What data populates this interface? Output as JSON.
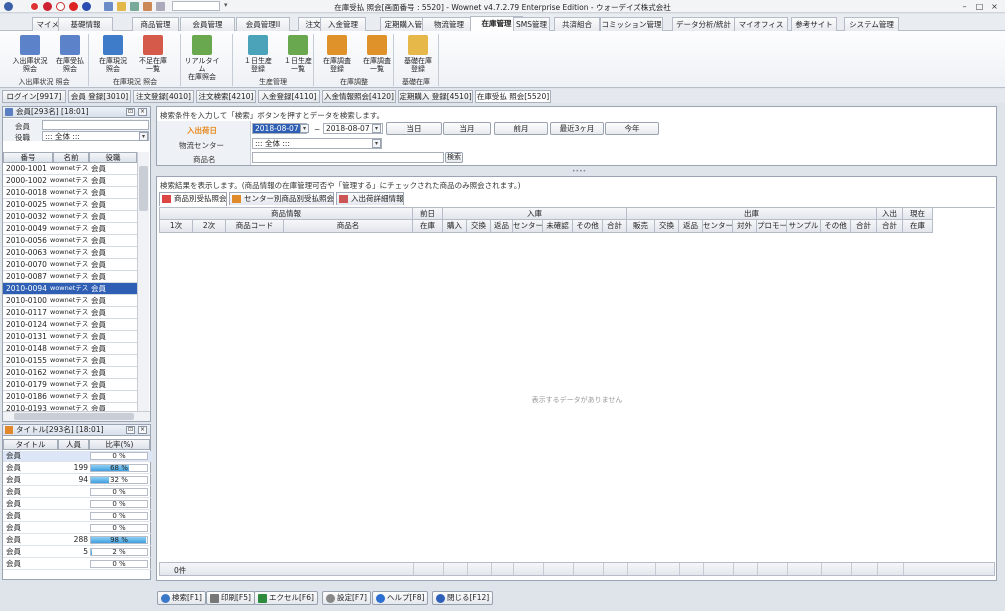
{
  "window": {
    "title": "在庫受払 照会[画面番号 : 5520] - Wownet v4.7.2.79 Enterprise Edition - ウォーデイズ株式会社"
  },
  "menu": {
    "tabs": [
      "マイメニュー",
      "基礎情報",
      "商品管理",
      "会員管理",
      "会員管理II",
      "注文管理",
      "入金管理",
      "定期購入管理",
      "物流管理",
      "在庫管理",
      "SMS管理",
      "共済組合",
      "コミッション管理",
      "データ分析/統計",
      "マイオフィス",
      "参考サイト",
      "システム管理"
    ],
    "active": "在庫管理"
  },
  "ribbon": {
    "buttons": [
      {
        "l1": "入出庫状況",
        "l2": "照会"
      },
      {
        "l1": "在庫受払",
        "l2": "照会"
      },
      {
        "l1": "在庫現況",
        "l2": "照会"
      },
      {
        "l1": "不足在庫",
        "l2": "一覧"
      },
      {
        "l1": "リアルタイム",
        "l2": "在庫照会"
      },
      {
        "l1": "１日生産",
        "l2": "登録"
      },
      {
        "l1": "１日生産",
        "l2": "一覧"
      },
      {
        "l1": "在庫調査",
        "l2": "登録"
      },
      {
        "l1": "在庫調査",
        "l2": "一覧"
      },
      {
        "l1": "基礎在庫",
        "l2": "登録"
      }
    ],
    "groups": [
      "入出庫状況 照会",
      "在庫現況 照会",
      "生産管理",
      "在庫調整",
      "基礎在庫"
    ]
  },
  "window_tabs": [
    "ログイン[9917]",
    "会員 登録[3010]",
    "注文登録[4010]",
    "注文検索[4210]",
    "入金登録[4110]",
    "入金情報照会[4120]",
    "定期購入 登録[4510]",
    "在庫受払 照会[5520]"
  ],
  "left_member": {
    "title": "会員[293名] [18:01]",
    "label_member": "会員",
    "label_role": "役職",
    "role_value": "::: 全体 :::",
    "columns": [
      "番号",
      "名前",
      "役職"
    ],
    "rows": [
      {
        "no": "2000-1001",
        "name": "wownetテスト",
        "role": "会員"
      },
      {
        "no": "2000-1002",
        "name": "wownetテスト",
        "role": "会員"
      },
      {
        "no": "2010-0018",
        "name": "wownetテスト",
        "role": "会員"
      },
      {
        "no": "2010-0025",
        "name": "wownetテスト",
        "role": "会員"
      },
      {
        "no": "2010-0032",
        "name": "wownetテスト",
        "role": "会員"
      },
      {
        "no": "2010-0049",
        "name": "wownetテスト",
        "role": "会員"
      },
      {
        "no": "2010-0056",
        "name": "wownetテスト",
        "role": "会員"
      },
      {
        "no": "2010-0063",
        "name": "wownetテスト",
        "role": "会員"
      },
      {
        "no": "2010-0070",
        "name": "wownetテスト",
        "role": "会員"
      },
      {
        "no": "2010-0087",
        "name": "wownetテスト",
        "role": "会員"
      },
      {
        "no": "2010-0094",
        "name": "wownetテスト",
        "role": "会員"
      },
      {
        "no": "2010-0100",
        "name": "wownetテスト",
        "role": "会員"
      },
      {
        "no": "2010-0117",
        "name": "wownetテスト",
        "role": "会員"
      },
      {
        "no": "2010-0124",
        "name": "wownetテスト",
        "role": "会員"
      },
      {
        "no": "2010-0131",
        "name": "wownetテスト",
        "role": "会員"
      },
      {
        "no": "2010-0148",
        "name": "wownetテスト",
        "role": "会員"
      },
      {
        "no": "2010-0155",
        "name": "wownetテスト",
        "role": "会員"
      },
      {
        "no": "2010-0162",
        "name": "wownetテスト",
        "role": "会員"
      },
      {
        "no": "2010-0179",
        "name": "wownetテスト",
        "role": "会員"
      },
      {
        "no": "2010-0186",
        "name": "wownetテスト",
        "role": "会員"
      },
      {
        "no": "2010-0193",
        "name": "wownetテスト",
        "role": "会員"
      }
    ],
    "selected_index": 10
  },
  "left_title": {
    "title": "タイトル[293名] [18:01]",
    "columns": [
      "タイトル",
      "人員",
      "比率(%)"
    ],
    "rows": [
      {
        "t": "会員",
        "n": "",
        "p": "0 %",
        "ratio": 0
      },
      {
        "t": "会員",
        "n": "199",
        "p": "68 %",
        "ratio": 0.68
      },
      {
        "t": "会員",
        "n": "94",
        "p": "32 %",
        "ratio": 0.32
      },
      {
        "t": "会員",
        "n": "",
        "p": "0 %",
        "ratio": 0
      },
      {
        "t": "会員",
        "n": "",
        "p": "0 %",
        "ratio": 0
      },
      {
        "t": "会員",
        "n": "",
        "p": "0 %",
        "ratio": 0
      },
      {
        "t": "会員",
        "n": "",
        "p": "0 %",
        "ratio": 0
      },
      {
        "t": "会員",
        "n": "288",
        "p": "98 %",
        "ratio": 0.98
      },
      {
        "t": "会員",
        "n": "5",
        "p": "2 %",
        "ratio": 0.02
      },
      {
        "t": "会員",
        "n": "",
        "p": "0 %",
        "ratio": 0
      }
    ]
  },
  "search": {
    "hint": "検索条件を入力して「検索」ボタンを押すとデータを検索します。",
    "label_date": "入出荷日",
    "date_from": "2018-08-07",
    "tilde": "~",
    "date_to": "2018-08-07",
    "quick": [
      "当日",
      "当月",
      "前月",
      "最近3ヶ月",
      "今年"
    ],
    "label_center": "物流センター",
    "center_value": "::: 全体 :::",
    "label_product": "商品名",
    "search_btn": "検索"
  },
  "results": {
    "hint": "検索結果を表示します。(商品情報の在庫管理可否や「管理する」にチェックされた商品のみ照会されます。)",
    "tabs": [
      "商品別受払照会",
      "センター別商品別受払照会",
      "入出荷詳細情報"
    ],
    "group_headers": [
      "商品情報",
      "前日",
      "入庫",
      "出庫",
      "入出",
      "現在"
    ],
    "columns": [
      "1次",
      "2次",
      "商品コード",
      "商品名",
      "在庫",
      "購入",
      "交換",
      "返品",
      "センター",
      "未確認",
      "その他",
      "合計",
      "販売",
      "交換",
      "返品",
      "センター",
      "対外",
      "プロモー",
      "サンプル",
      "その他",
      "合計",
      "合計",
      "在庫"
    ],
    "empty": "表示するデータがありません",
    "count": "0件"
  },
  "footer": {
    "buttons": [
      "検索[F1]",
      "印刷[F5]",
      "エクセル[F6]",
      "設定[F7]",
      "ヘルプ[F8]",
      "閉じる[F12]"
    ]
  },
  "colors": {
    "accent": "#2f5fb4",
    "bar": "#3f9fe0",
    "highlight": "#e98a1f"
  }
}
